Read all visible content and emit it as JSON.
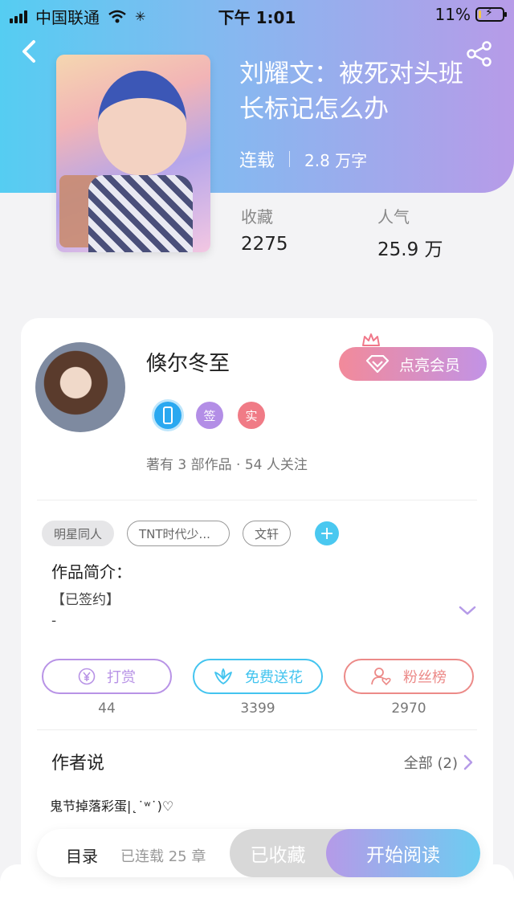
{
  "status_bar": {
    "carrier": "中国联通",
    "time": "下午 1:01",
    "battery": "11%",
    "battery_level": 0.11
  },
  "book": {
    "title": "刘耀文：被死对头班长标记怎么办",
    "status": "连载",
    "word_count": "2.8 万字",
    "stats": [
      {
        "label": "收藏",
        "value": "2275"
      },
      {
        "label": "人气",
        "value": "25.9 万"
      }
    ]
  },
  "author": {
    "name": "倏尔冬至",
    "vip_button": "点亮会员",
    "badges": [
      {
        "icon": "phone-badge-icon",
        "text": "",
        "color": "#2aa8f0"
      },
      {
        "icon": "sign-badge-icon",
        "text": "签",
        "color": "#b38ee6"
      },
      {
        "icon": "real-name-badge-icon",
        "text": "实",
        "color": "#f07b86"
      }
    ],
    "info": "著有 3 部作品 · 54 人关注"
  },
  "tags": [
    "明星同人",
    "TNT时代少...",
    "文轩"
  ],
  "intro": {
    "title": "作品简介：",
    "body": "【已签约】\n-"
  },
  "actions": [
    {
      "label": "打赏",
      "count": "44",
      "color": "#b893e6",
      "icon": "yuan-icon"
    },
    {
      "label": "免费送花",
      "count": "3399",
      "color": "#43c4ef",
      "icon": "flower-icon"
    },
    {
      "label": "粉丝榜",
      "count": "2970",
      "color": "#ec8a88",
      "icon": "fan-rank-icon"
    }
  ],
  "author_says": {
    "title": "作者说",
    "all_label": "全部 (2)",
    "latest": "鬼节掉落彩蛋|˛˙ʷ˙)♡"
  },
  "bottom_bar": {
    "toc": "目录",
    "chapters": "已连载 25 章",
    "favorited": "已收藏",
    "read": "开始阅读"
  },
  "colors": {
    "accent_purple": "#b59ae8",
    "accent_blue": "#55cdf2"
  }
}
